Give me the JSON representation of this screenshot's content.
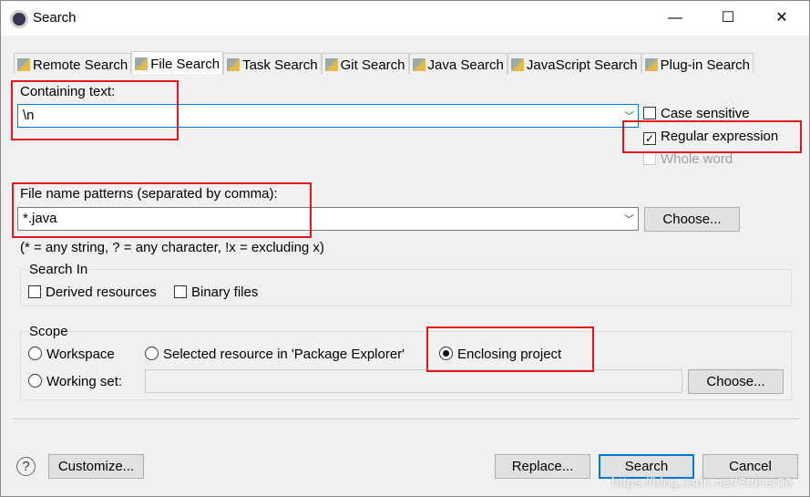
{
  "window": {
    "title": "Search",
    "minimize": "—",
    "maximize": "☐",
    "close": "✕"
  },
  "tabs": [
    {
      "label": "Remote Search",
      "active": false
    },
    {
      "label": "File Search",
      "active": true
    },
    {
      "label": "Task Search",
      "active": false
    },
    {
      "label": "Git Search",
      "active": false
    },
    {
      "label": "Java Search",
      "active": false
    },
    {
      "label": "JavaScript Search",
      "active": false
    },
    {
      "label": "Plug-in Search",
      "active": false
    }
  ],
  "containing": {
    "label": "Containing text:",
    "value": "\\n",
    "case_sensitive": {
      "label": "Case sensitive",
      "checked": false
    },
    "regex": {
      "label": "Regular expression",
      "checked": true
    },
    "whole_word": {
      "label": "Whole word",
      "checked": false,
      "disabled": true
    }
  },
  "patterns": {
    "label": "File name patterns (separated by comma):",
    "value": "*.java",
    "choose": "Choose...",
    "hint": "(* = any string, ? = any character, !x = excluding x)"
  },
  "search_in": {
    "label": "Search In",
    "derived": {
      "label": "Derived resources",
      "checked": false
    },
    "binary": {
      "label": "Binary files",
      "checked": false
    }
  },
  "scope": {
    "label": "Scope",
    "workspace": "Workspace",
    "selected": "Selected resource in 'Package Explorer'",
    "enclosing": "Enclosing project",
    "working_set": "Working set:",
    "working_set_value": "",
    "choose": "Choose...",
    "selected_option": "Enclosing project"
  },
  "footer": {
    "help": "?",
    "customize": "Customize...",
    "replace": "Replace...",
    "search": "Search",
    "cancel": "Cancel"
  },
  "watermark": "https://blog.csdn.net/Striver00",
  "colors": {
    "accent": "#0078d7",
    "highlight_box": "#e8141c"
  }
}
